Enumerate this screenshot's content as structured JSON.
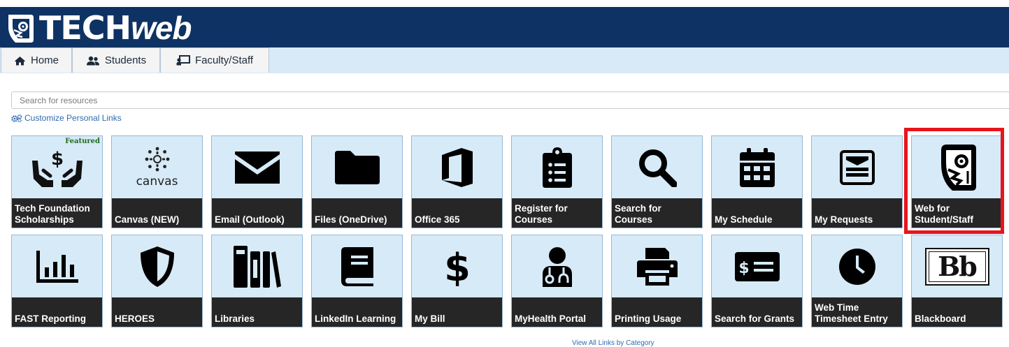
{
  "header": {
    "brand_part1": "TECH",
    "brand_part2": "web",
    "logo_icon": "owl-logo-icon",
    "background_color": "#0e3263"
  },
  "nav": {
    "tabs": [
      {
        "label": "Home",
        "icon": "home-icon"
      },
      {
        "label": "Students",
        "icon": "users-icon"
      },
      {
        "label": "Faculty/Staff",
        "icon": "chalkboard-teacher-icon"
      }
    ]
  },
  "search": {
    "placeholder": "Search for resources",
    "value": ""
  },
  "customize": {
    "label": "Customize Personal Links",
    "icon": "cogs-icon"
  },
  "tiles": {
    "row1": [
      {
        "label": "Tech Foundation Scholarships",
        "icon": "hands-dollar-icon",
        "badge": "Featured"
      },
      {
        "label": "Canvas (NEW)",
        "icon": "canvas-logo-icon",
        "logo_text": "canvas"
      },
      {
        "label": "Email (Outlook)",
        "icon": "envelope-icon"
      },
      {
        "label": "Files (OneDrive)",
        "icon": "folder-icon"
      },
      {
        "label": "Office 365",
        "icon": "office-logo-icon"
      },
      {
        "label": "Register for Courses",
        "icon": "clipboard-list-icon"
      },
      {
        "label": "Search for Courses",
        "icon": "search-icon"
      },
      {
        "label": "My Schedule",
        "icon": "calendar-icon"
      },
      {
        "label": "My Requests",
        "icon": "newspaper-icon"
      },
      {
        "label": "Web for Student/Staff",
        "icon": "owl-logo-icon",
        "highlighted": true
      }
    ],
    "row2": [
      {
        "label": "FAST Reporting",
        "icon": "bar-chart-icon"
      },
      {
        "label": "HEROES",
        "icon": "shield-icon"
      },
      {
        "label": "Libraries",
        "icon": "books-icon"
      },
      {
        "label": "LinkedIn Learning",
        "icon": "book-icon"
      },
      {
        "label": "My Bill",
        "icon": "dollar-sign-icon"
      },
      {
        "label": "MyHealth Portal",
        "icon": "doctor-icon"
      },
      {
        "label": "Printing Usage",
        "icon": "printer-icon"
      },
      {
        "label": "Search for Grants",
        "icon": "money-check-icon"
      },
      {
        "label": "Web Time Timesheet Entry",
        "icon": "clock-icon"
      },
      {
        "label": "Blackboard",
        "icon": "blackboard-logo-icon",
        "logo_text": "Bb"
      }
    ]
  },
  "footer": {
    "view_all_label": "View All Links by Category"
  },
  "colors": {
    "tile_background": "#d7eaf7",
    "caption_background": "#262626",
    "highlight_border": "#e8141c",
    "link": "#2e6bb0"
  }
}
